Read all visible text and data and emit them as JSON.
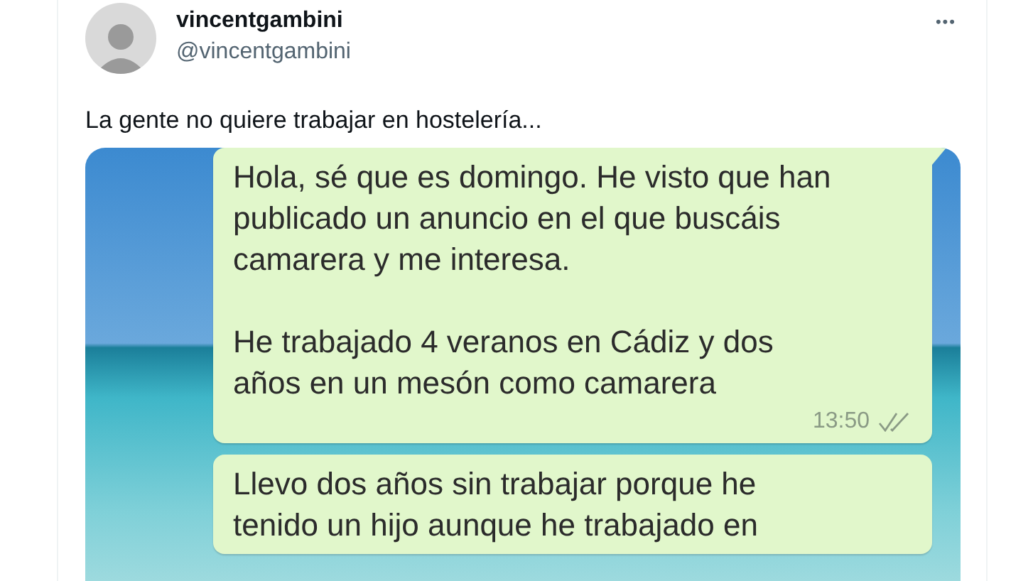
{
  "author": {
    "name": "vincentgambini",
    "handle": "@vincentgambini"
  },
  "more_button": "•••",
  "tweet_text": "La gente no quiere trabajar en hostelería...",
  "messages": [
    {
      "paragraphs": [
        "Hola, sé que es domingo. He visto que han publicado un anuncio en el que buscáis camarera y me interesa.",
        "He trabajado 4 veranos en Cádiz y dos años en un mesón como camarera"
      ],
      "time": "13:50"
    },
    {
      "paragraphs": [
        "Llevo dos años sin trabajar porque he tenido un hijo aunque he trabajado en"
      ]
    }
  ]
}
